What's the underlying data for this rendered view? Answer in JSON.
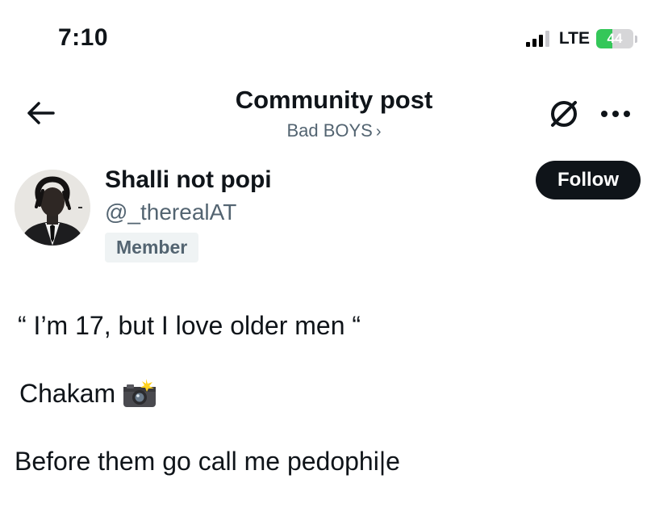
{
  "status_bar": {
    "time": "7:10",
    "network": "LTE",
    "battery_level": "44",
    "battery_fraction": 0.44,
    "signal_bars_active": 3,
    "signal_bars_total": 4
  },
  "nav": {
    "title": "Community post",
    "community": "Bad BOYS",
    "community_chevron": "›",
    "back_icon": "arrow-left-icon",
    "grok_icon": "grok-icon",
    "more_icon": "more-horizontal-icon"
  },
  "author": {
    "name": "Shalli not popi",
    "handle": "@_therealAT",
    "badge": "Member",
    "follow_label": "Follow"
  },
  "post": {
    "line1": "“  I’m 17, but I love older men “",
    "line2": "Chakam",
    "line2_emoji": "camera-with-flash-icon",
    "line3": "Before them go call me pedophi|e"
  },
  "colors": {
    "text_primary": "#0f1419",
    "text_secondary": "#536471",
    "badge_bg": "#eff3f4",
    "battery_green": "#34c759"
  }
}
